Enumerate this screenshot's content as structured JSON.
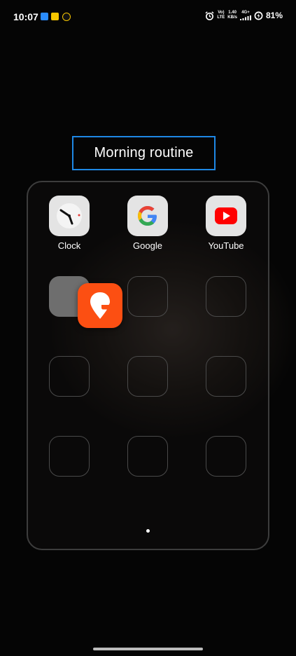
{
  "status_bar": {
    "time": "10:07",
    "network_top": "Vo)",
    "network_bottom": "LTE",
    "speed_top": "1.40",
    "speed_bottom": "KB/s",
    "signal_type": "4G+",
    "battery": "81%"
  },
  "folder": {
    "title": "Morning routine",
    "apps": [
      {
        "label": "Clock",
        "icon": "clock-icon"
      },
      {
        "label": "Google",
        "icon": "google-icon"
      },
      {
        "label": "YouTube",
        "icon": "youtube-icon"
      }
    ],
    "dragging_app_icon": "swiggy-icon"
  },
  "colors": {
    "title_border": "#1e88e5",
    "youtube_red": "#ff0000",
    "swiggy_orange": "#fc4f12"
  }
}
